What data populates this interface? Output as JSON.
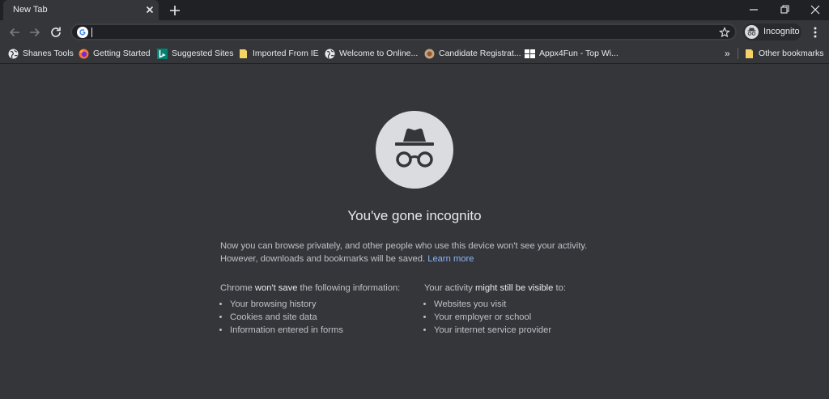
{
  "tab": {
    "title": "New Tab"
  },
  "omnibox": {
    "value": ""
  },
  "profile": {
    "label": "Incognito"
  },
  "bookmarks": {
    "items": [
      {
        "label": "Shanes Tools",
        "icon": "globe-icon"
      },
      {
        "label": "Getting Started",
        "icon": "firefox-icon"
      },
      {
        "label": "Suggested Sites",
        "icon": "bing-icon"
      },
      {
        "label": "Imported From IE",
        "icon": "folder-icon"
      },
      {
        "label": "Welcome to Online...",
        "icon": "globe-icon"
      },
      {
        "label": "Candidate Registrat...",
        "icon": "site-icon"
      },
      {
        "label": "Appx4Fun - Top Wi...",
        "icon": "windows-icon"
      }
    ],
    "overflow": "»",
    "other": {
      "label": "Other bookmarks",
      "icon": "folder-icon"
    }
  },
  "page": {
    "heading": "You've gone incognito",
    "intro_line1": "Now you can browse privately, and other people who use this device won't see your activity.",
    "intro_line2": "However, downloads and bookmarks will be saved.",
    "learn_more": "Learn more",
    "left_col": {
      "pre": "Chrome",
      "emph": "won't save",
      "post": "the following information:",
      "items": [
        "Your browsing history",
        "Cookies and site data",
        "Information entered in forms"
      ]
    },
    "right_col": {
      "pre": "Your activity",
      "emph": "might still be visible",
      "post": "to:",
      "items": [
        "Websites you visit",
        "Your employer or school",
        "Your internet service provider"
      ]
    }
  },
  "colors": {
    "page_bg": "#35363a",
    "frame_bg": "#202124",
    "link": "#8ab4f8",
    "text": "#bdc1c6"
  }
}
